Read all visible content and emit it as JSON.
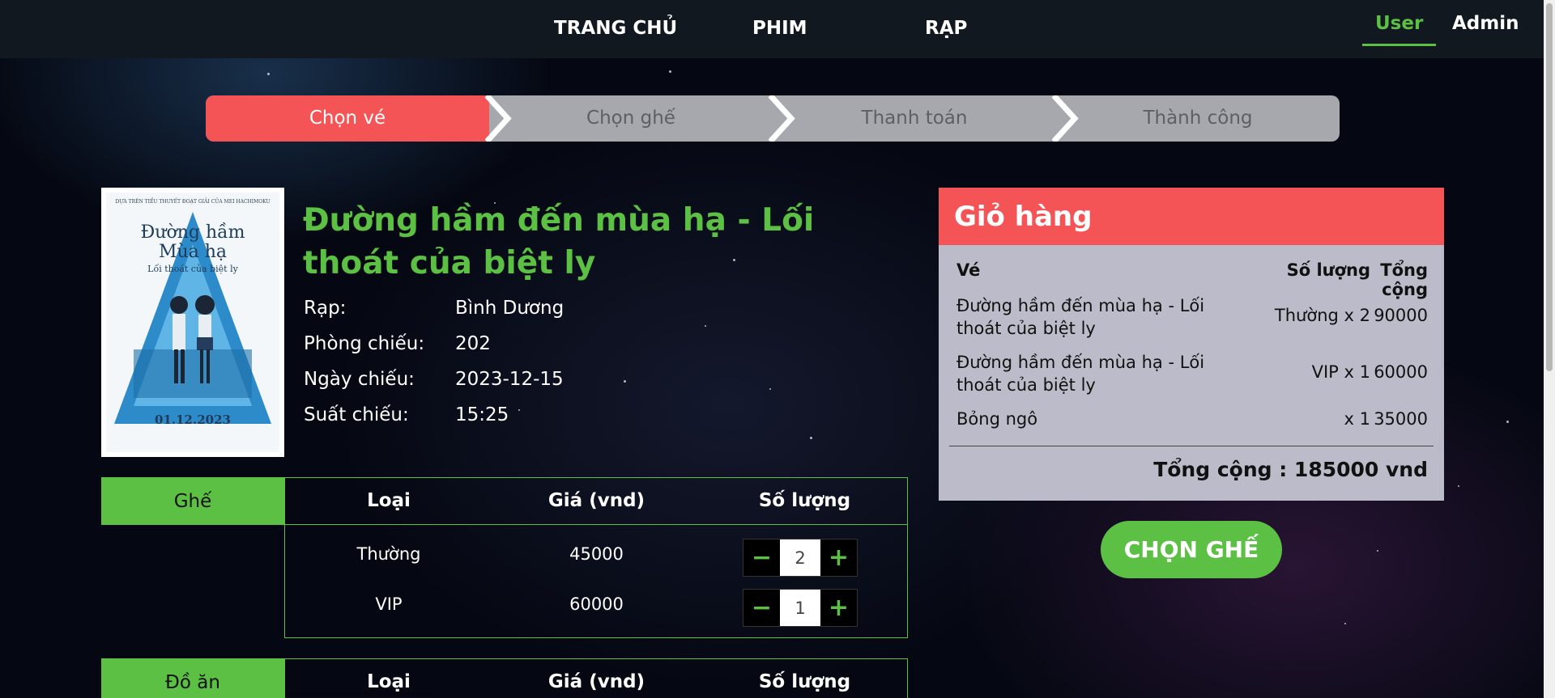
{
  "nav": {
    "links": [
      "TRANG CHỦ",
      "PHIM",
      "RẠP"
    ],
    "roles": {
      "user": "User",
      "admin": "Admin"
    }
  },
  "steps": [
    "Chọn vé",
    "Chọn ghế",
    "Thanh toán",
    "Thành công"
  ],
  "active_step": 0,
  "movie": {
    "title": "Đường hầm đến mùa hạ - Lối thoát của biệt ly",
    "poster": {
      "top_text": "DỰA TRÊN TIỂU THUYẾT ĐOẠT GIẢI CỦA MEI HACHIMOKU",
      "title_lines": [
        "Đường hầm",
        "Mùa hạ"
      ],
      "subtitle": "Lối thoát của biệt ly",
      "date": "01.12.2023"
    },
    "info": [
      {
        "label": "Rạp:",
        "value": "Bình Dương"
      },
      {
        "label": "Phòng chiếu:",
        "value": "202"
      },
      {
        "label": "Ngày chiếu:",
        "value": "2023-12-15"
      },
      {
        "label": "Suất chiếu:",
        "value": "15:25"
      }
    ]
  },
  "seat_table": {
    "section_label": "Ghế",
    "headers": [
      "Loại",
      "Giá (vnd)",
      "Số lượng"
    ],
    "rows": [
      {
        "type": "Thường",
        "price": "45000",
        "qty": "2"
      },
      {
        "type": "VIP",
        "price": "60000",
        "qty": "1"
      }
    ]
  },
  "food_table": {
    "section_label": "Đồ ăn",
    "headers": [
      "Loại",
      "Giá (vnd)",
      "Số lượng"
    ]
  },
  "qty_controls": {
    "minus": "−",
    "plus": "+"
  },
  "cart": {
    "title": "Giỏ hàng",
    "headers": [
      "Vé",
      "Số lượng",
      "Tổng cộng"
    ],
    "items": [
      {
        "name_line1": "Đường hầm đến mùa hạ - Lối",
        "name_line2": "thoát của biệt ly",
        "qty": "Thường x 2",
        "total": "90000"
      },
      {
        "name_line1": "Đường hầm đến mùa hạ - Lối",
        "name_line2": "thoát của biệt ly",
        "qty": "VIP x 1",
        "total": "60000"
      },
      {
        "name_line1": "Bỏng ngô",
        "name_line2": "",
        "qty": "x 1",
        "total": "35000"
      }
    ],
    "grand_total": "Tổng cộng : 185000 vnd"
  },
  "cta": {
    "label": "CHỌN GHẾ"
  },
  "colors": {
    "accent": "#5bc043",
    "primary": "#f55456",
    "step_inactive": "#a6a8ae",
    "nav_bg": "#111820",
    "cart_bg": "#bbbbc9"
  }
}
